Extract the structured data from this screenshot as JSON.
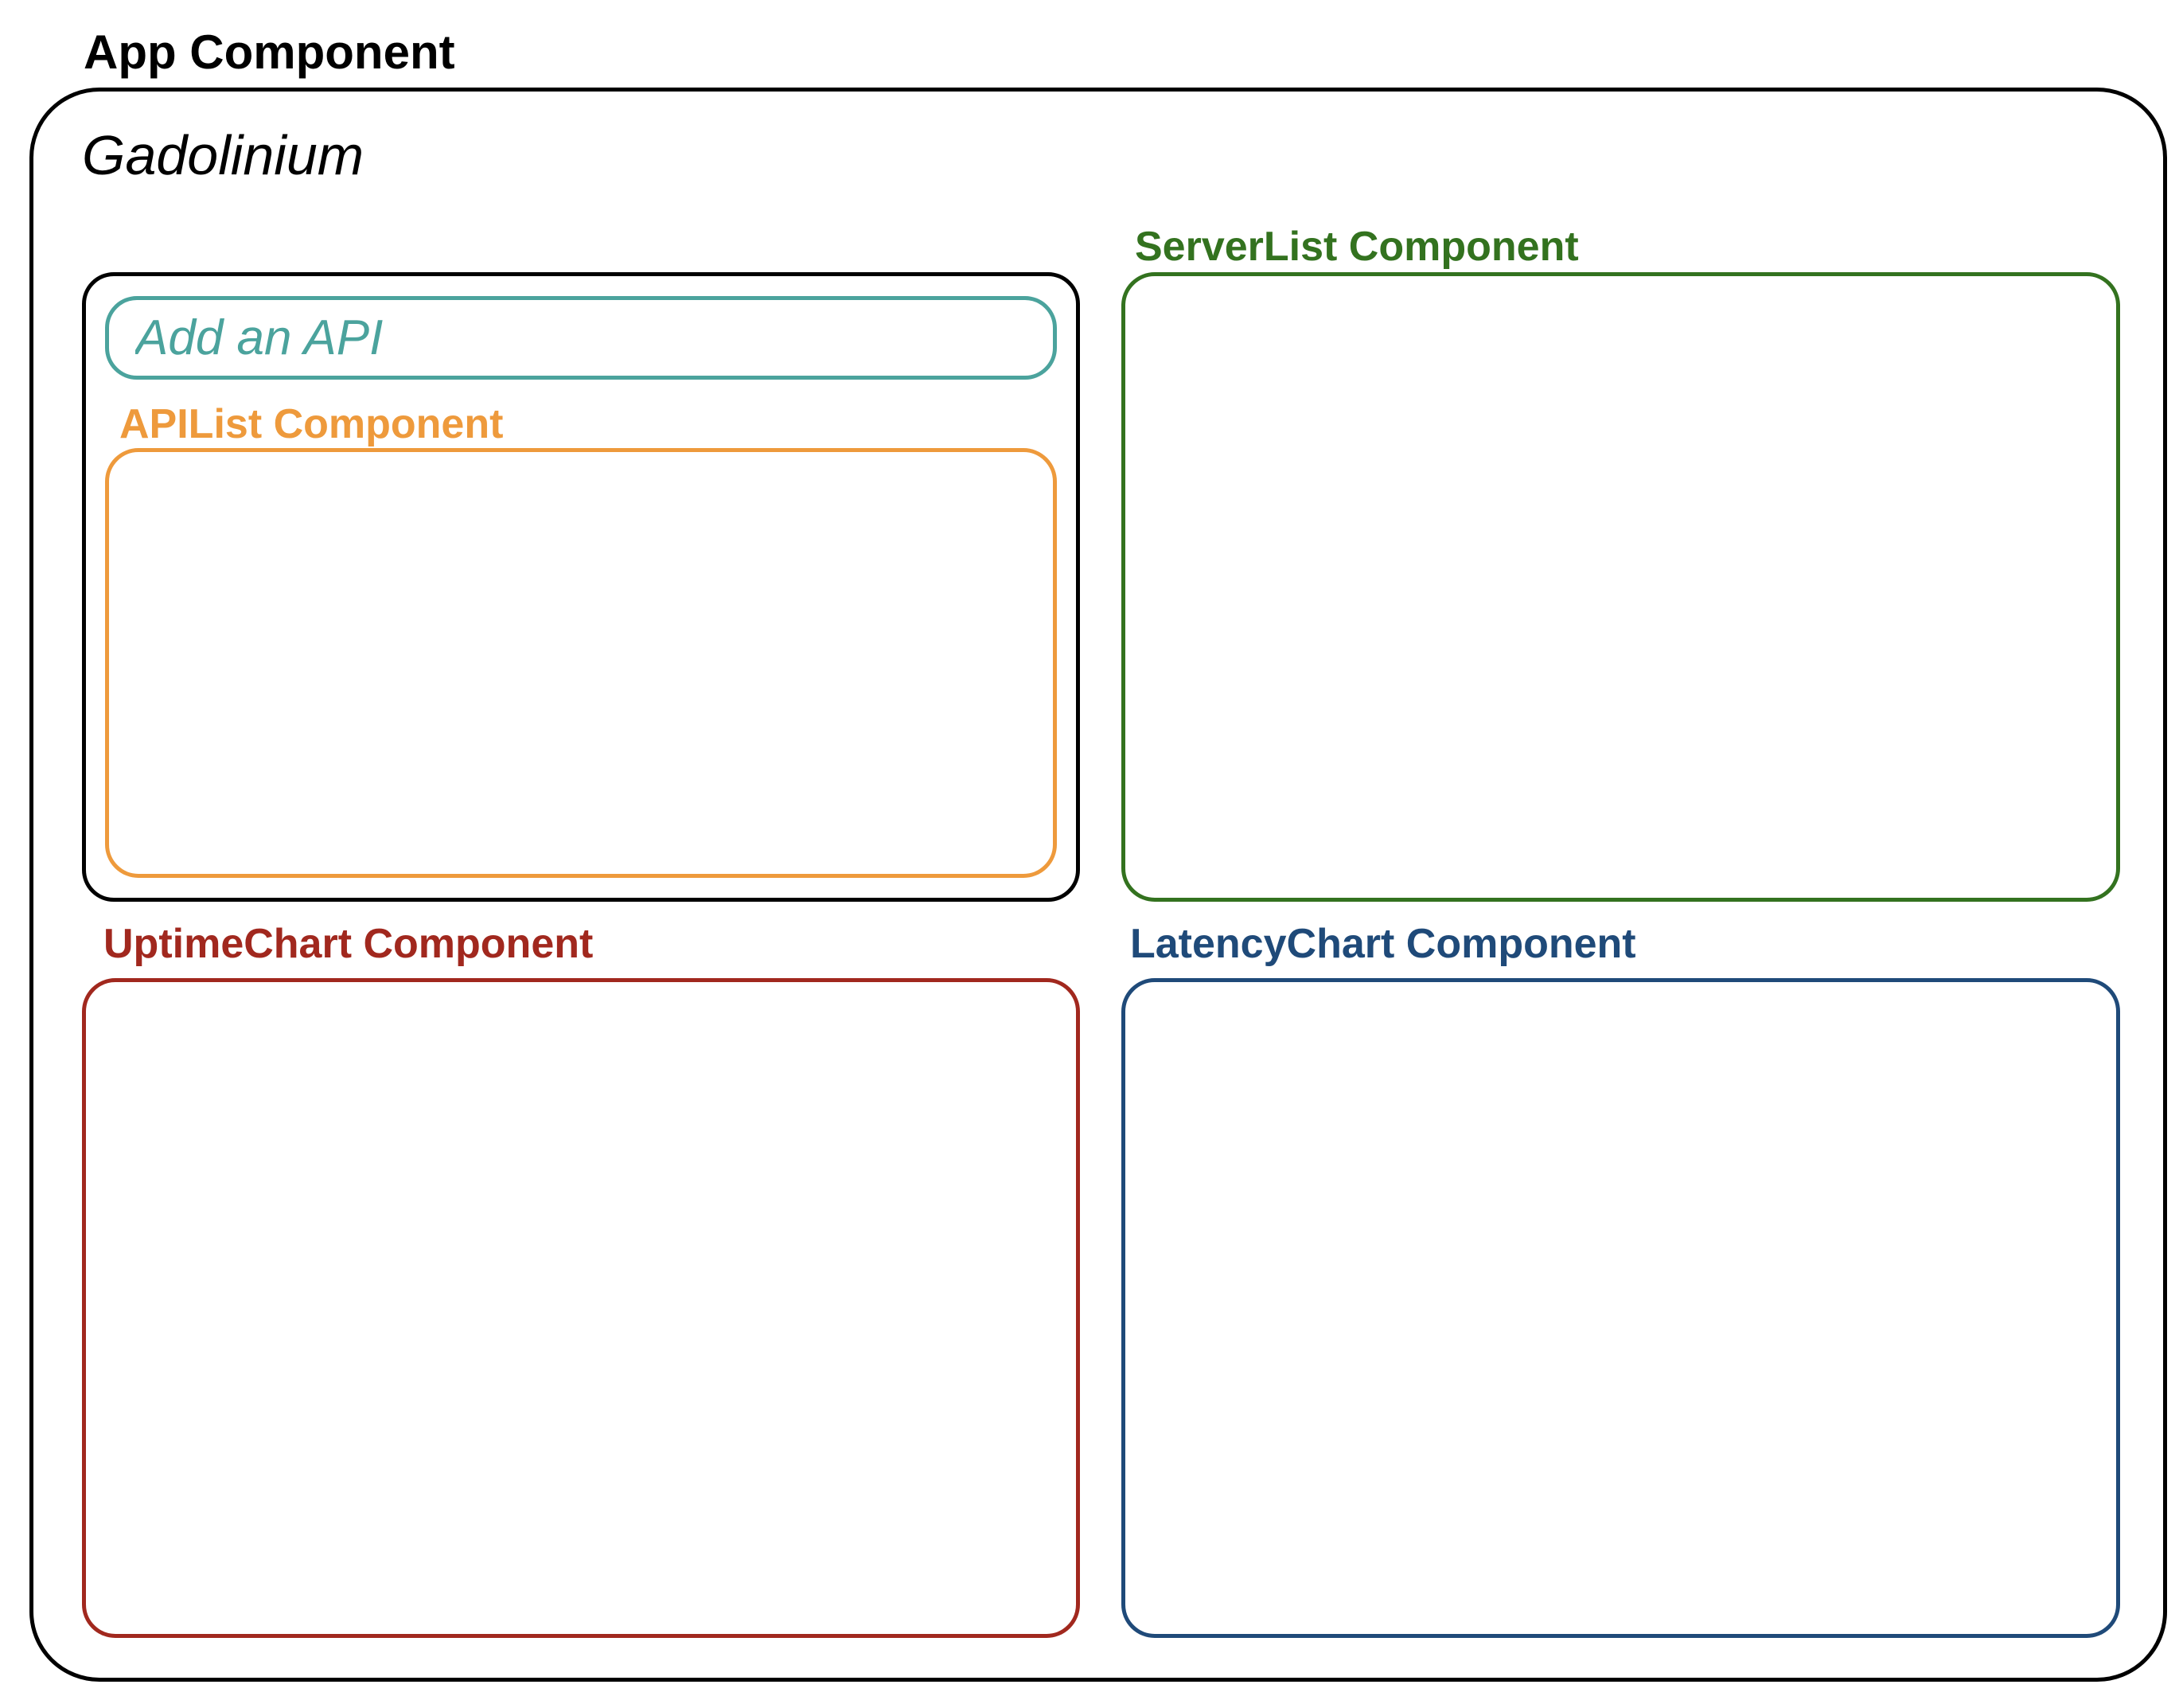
{
  "app": {
    "label": "App Component",
    "title": "Gadolinium",
    "color": "#000000"
  },
  "add_api": {
    "placeholder": "Add an API",
    "color": "#4ba39d"
  },
  "api_list": {
    "label": "APIList Component",
    "color": "#ee9a3c"
  },
  "server_list": {
    "label": "ServerList Component",
    "color": "#33721f"
  },
  "uptime_chart": {
    "label": "UptimeChart Component",
    "color": "#a1281e"
  },
  "latency_chart": {
    "label": "LatencyChart Component",
    "color": "#1f4a79"
  }
}
